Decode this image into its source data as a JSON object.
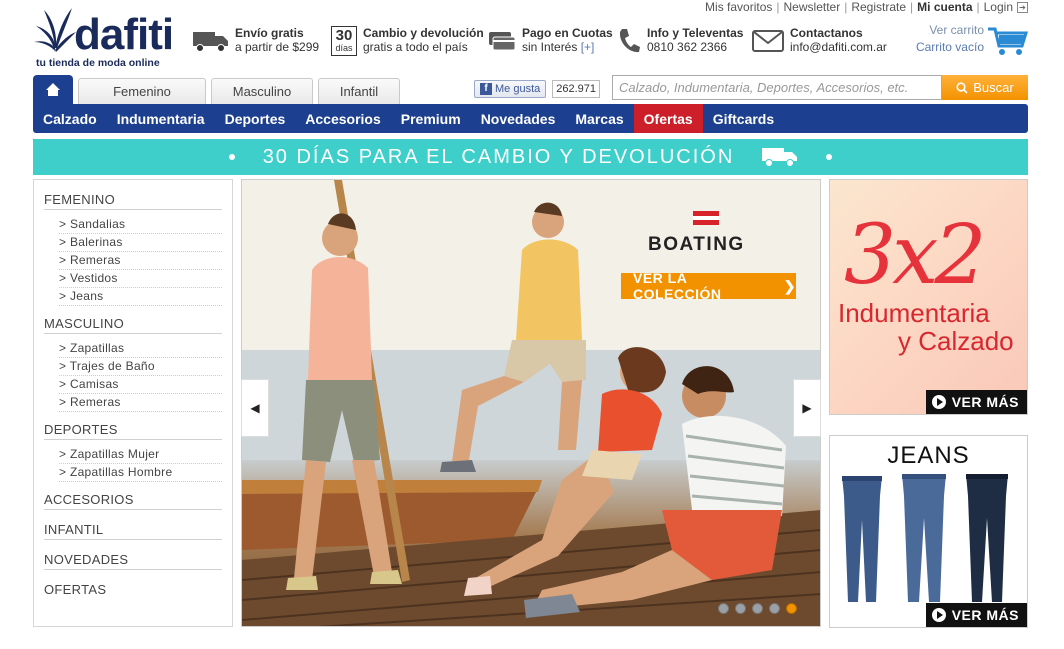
{
  "top_links": {
    "favoritos": "Mis favoritos",
    "newsletter": "Newsletter",
    "registrate": "Registrate",
    "mi_cuenta": "Mi cuenta",
    "login": "Login"
  },
  "logo": {
    "word": "dafiti",
    "tagline": "tu tienda de moda online"
  },
  "info": [
    {
      "title": "Envío gratis",
      "sub": "a partir de $299",
      "icon": "truck-icon"
    },
    {
      "title": "Cambio y devolución",
      "sub": "gratis a todo el país",
      "icon": "calendar-30-icon",
      "badge_top": "30",
      "badge_bottom": "días"
    },
    {
      "title": "Pago en Cuotas",
      "sub": "sin Interés",
      "sub_extra": "[+]",
      "icon": "credit-card-icon"
    },
    {
      "title": "Info y Televentas",
      "sub": "0810 362 2366",
      "icon": "phone-icon"
    },
    {
      "title": "Contactanos",
      "sub": "info@dafiti.com.ar",
      "icon": "envelope-icon"
    }
  ],
  "cart": {
    "view": "Ver carrito",
    "status": "Carrito vacío"
  },
  "tabs": [
    "Femenino",
    "Masculino",
    "Infantil"
  ],
  "facebook": {
    "like": "Me gusta",
    "count": "262.971"
  },
  "search": {
    "placeholder": "Calzado, Indumentaria, Deportes, Accesorios, etc.",
    "button": "Buscar"
  },
  "main_nav": [
    "Calzado",
    "Indumentaria",
    "Deportes",
    "Accesorios",
    "Premium",
    "Novedades",
    "Marcas",
    "Ofertas",
    "Giftcards"
  ],
  "promo": "30 DÍAS PARA EL CAMBIO Y DEVOLUCIÓN",
  "sidebar": {
    "femenino": {
      "title": "FEMENINO",
      "items": [
        "> Sandalias",
        "> Balerinas",
        "> Remeras",
        "> Vestidos",
        "> Jeans"
      ]
    },
    "masculino": {
      "title": "MASCULINO",
      "items": [
        "> Zapatillas",
        "> Trajes de Baño",
        "> Camisas",
        "> Remeras"
      ]
    },
    "deportes": {
      "title": "DEPORTES",
      "items": [
        "> Zapatillas Mujer",
        "> Zapatillas Hombre"
      ]
    },
    "accesorios": "ACCESORIOS",
    "infantil": "INFANTIL",
    "novedades": "NOVEDADES",
    "ofertas": "OFERTAS"
  },
  "slider": {
    "brand": "BOATING",
    "cta": "VER LA COLECCIÓN",
    "slides": 5,
    "active_slide": 5
  },
  "banner_1": {
    "big": "3x2",
    "line1": "Indumentaria",
    "line2": "y Calzado",
    "cta": "VER MÁS"
  },
  "banner_2": {
    "title": "JEANS",
    "cta": "VER MÁS"
  },
  "colors": {
    "nav_blue": "#1d3f8f",
    "offer_red": "#cc1f2a",
    "accent_orange": "#f39200",
    "promo_teal": "#3ecfcb"
  }
}
